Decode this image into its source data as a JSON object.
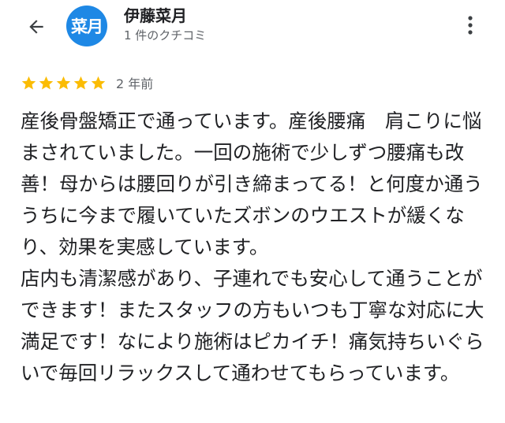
{
  "header": {
    "avatar_text": "菜月",
    "user_name": "伊藤菜月",
    "user_meta": "1 件のクチコミ"
  },
  "review": {
    "rating": 5,
    "max_rating": 5,
    "time_ago": "2 年前",
    "paragraphs": [
      "産後骨盤矯正で通っています。産後腰痛　肩こりに悩まされていました。一回の施術で少しずつ腰痛も改善！母からは腰回りが引き締まってる！と何度か通ううちに今まで履いていたズボンのウエストが緩くなり、効果を実感しています。",
      "店内も清潔感があり、子連れでも安心して通うことができます！またスタッフの方もいつも丁寧な対応に大満足です！なにより施術はピカイチ！痛気持ちいぐらいで毎回リラックスして通わせてもらっています。"
    ]
  },
  "colors": {
    "avatar_bg": "#1e88e5",
    "star": "#fbbc04",
    "secondary_text": "#5f6368",
    "primary_text": "#202124"
  },
  "icons": {
    "back": "back-arrow-icon",
    "more": "more-vert-icon",
    "star": "star-icon"
  }
}
